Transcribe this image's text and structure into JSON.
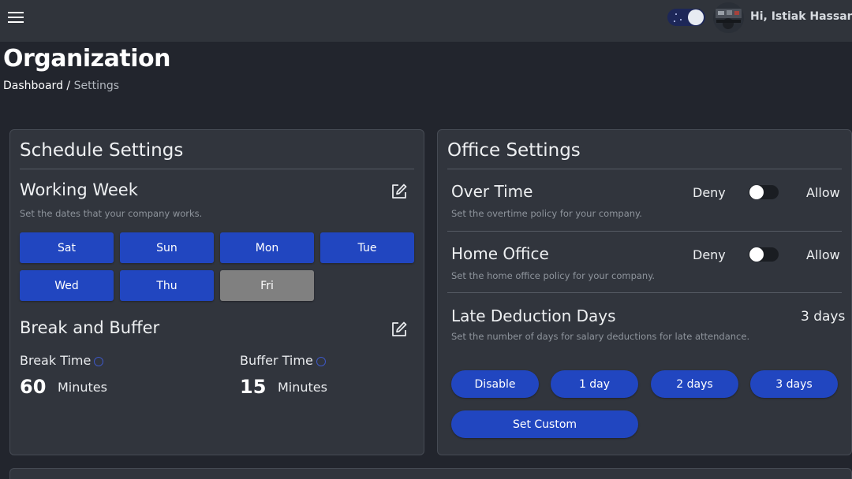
{
  "header": {
    "greeting": "Hi, Istiak Hassan",
    "theme_mode": "dark",
    "icons": {
      "menu": "hamburger-icon",
      "dropdown": "chevron-down-icon",
      "user": "avatar"
    }
  },
  "page": {
    "title": "Organization",
    "breadcrumb": {
      "parent": "Dashboard",
      "separator": "/",
      "current": "Settings"
    }
  },
  "schedule": {
    "title": "Schedule Settings",
    "working_week": {
      "title": "Working Week",
      "helper": "Set the dates that your company works.",
      "days": [
        {
          "label": "Sat",
          "active": true
        },
        {
          "label": "Sun",
          "active": true
        },
        {
          "label": "Mon",
          "active": true
        },
        {
          "label": "Tue",
          "active": true
        },
        {
          "label": "Wed",
          "active": true
        },
        {
          "label": "Thu",
          "active": true
        },
        {
          "label": "Fri",
          "active": false
        }
      ]
    },
    "break_buffer": {
      "title": "Break and Buffer",
      "break_label": "Break Time",
      "break_value": "60",
      "break_unit": "Minutes",
      "buffer_label": "Buffer Time",
      "buffer_value": "15",
      "buffer_unit": "Minutes"
    }
  },
  "office": {
    "title": "Office Settings",
    "overtime": {
      "title": "Over Time",
      "helper": "Set the overtime policy for your company.",
      "deny_label": "Deny",
      "allow_label": "Allow",
      "enabled": false
    },
    "home_office": {
      "title": "Home Office",
      "helper": "Set the home office policy for your company.",
      "deny_label": "Deny",
      "allow_label": "Allow",
      "enabled": false
    },
    "late_deduction": {
      "title": "Late Deduction Days",
      "value": "3 days",
      "helper": "Set the number of days for salary deductions for late attendance.",
      "options": [
        "Disable",
        "1 day",
        "2 days",
        "3 days"
      ],
      "custom_label": "Set Custom"
    }
  },
  "colors": {
    "accent": "#2146c0",
    "disabled_day": "#808080",
    "background": "#22252d",
    "card": "#31353d"
  }
}
